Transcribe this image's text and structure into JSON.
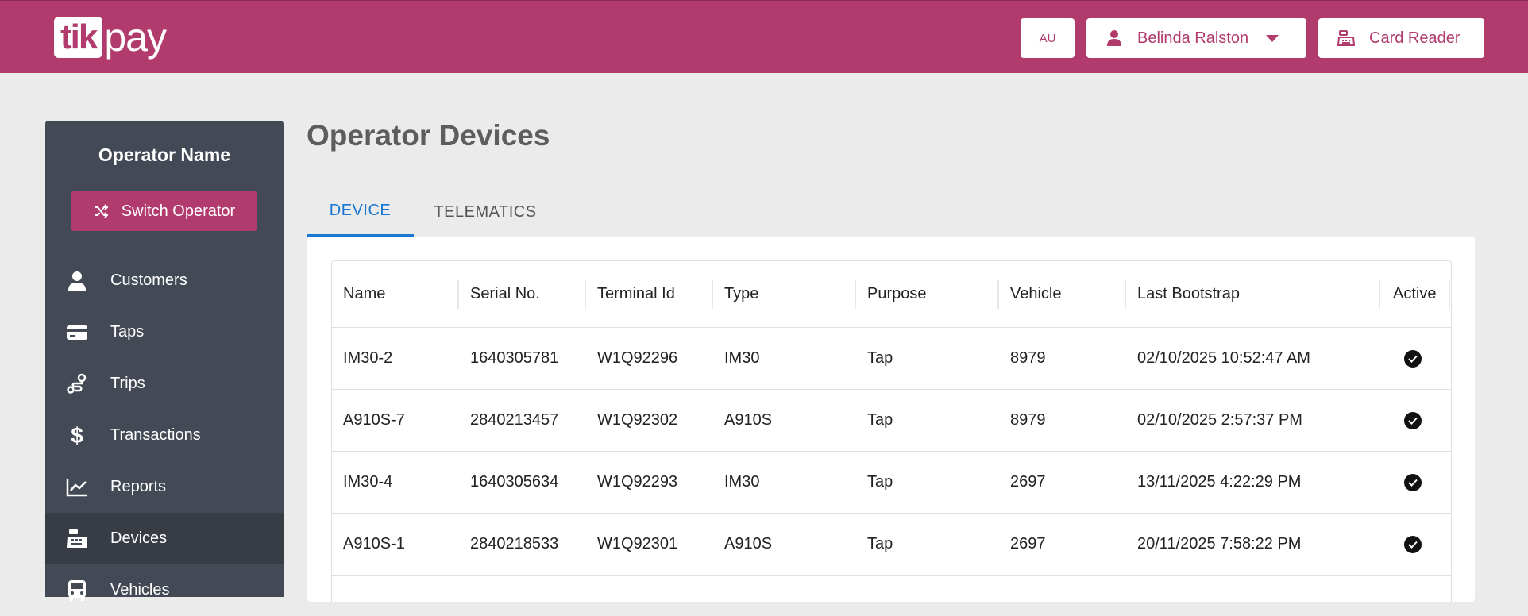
{
  "header": {
    "logo_main": "tik",
    "logo_rest": "pay",
    "region": "AU",
    "user_name": "Belinda Ralston",
    "card_reader": "Card Reader",
    "brand_color": "#b13b6d"
  },
  "sidebar": {
    "operator_name": "Operator Name",
    "switch_label": "Switch Operator",
    "items": [
      {
        "label": "Customers",
        "icon": "person-icon"
      },
      {
        "label": "Taps",
        "icon": "card-icon"
      },
      {
        "label": "Trips",
        "icon": "route-icon"
      },
      {
        "label": "Transactions",
        "icon": "dollar-icon"
      },
      {
        "label": "Reports",
        "icon": "chart-icon"
      },
      {
        "label": "Devices",
        "icon": "cash-register-icon",
        "active": true
      },
      {
        "label": "Vehicles",
        "icon": "bus-icon"
      }
    ]
  },
  "main": {
    "title": "Operator Devices",
    "tabs": [
      {
        "label": "DEVICE",
        "active": true
      },
      {
        "label": "TELEMATICS",
        "active": false
      }
    ],
    "table": {
      "columns": [
        "Name",
        "Serial No.",
        "Terminal Id",
        "Type",
        "Purpose",
        "Vehicle",
        "Last Bootstrap",
        "Active"
      ],
      "rows": [
        {
          "name": "IM30-2",
          "serial": "1640305781",
          "terminal": "W1Q92296",
          "type": "IM30",
          "purpose": "Tap",
          "vehicle": "8979",
          "bootstrap": "02/10/2025 10:52:47 AM",
          "active": true
        },
        {
          "name": "A910S-7",
          "serial": "2840213457",
          "terminal": "W1Q92302",
          "type": "A910S",
          "purpose": "Tap",
          "vehicle": "8979",
          "bootstrap": "02/10/2025 2:57:37 PM",
          "active": true
        },
        {
          "name": "IM30-4",
          "serial": "1640305634",
          "terminal": "W1Q92293",
          "type": "IM30",
          "purpose": "Tap",
          "vehicle": "2697",
          "bootstrap": "13/11/2025 4:22:29 PM",
          "active": true
        },
        {
          "name": "A910S-1",
          "serial": "2840218533",
          "terminal": "W1Q92301",
          "type": "A910S",
          "purpose": "Tap",
          "vehicle": "2697",
          "bootstrap": "20/11/2025 7:58:22 PM",
          "active": true
        }
      ]
    }
  }
}
